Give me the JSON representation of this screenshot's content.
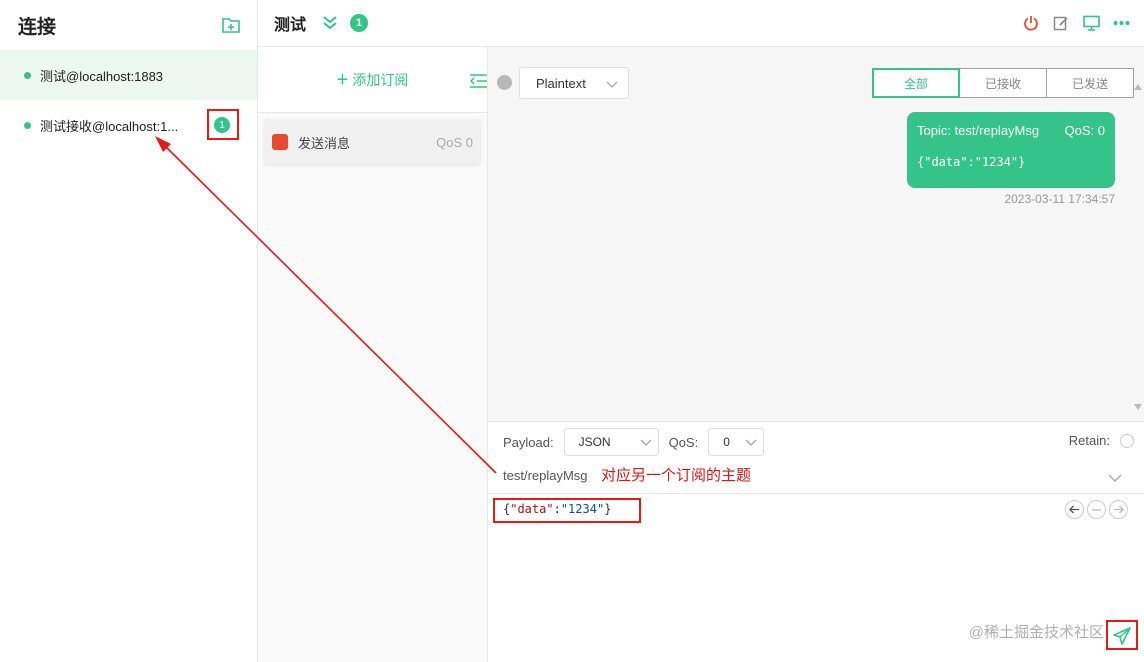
{
  "sidebar": {
    "title": "连接",
    "connections": [
      {
        "name": "测试@localhost:1883",
        "active": true
      },
      {
        "name": "测试接收@localhost:1...",
        "active": false,
        "badge": "1"
      }
    ]
  },
  "topbar": {
    "title": "测试",
    "badge": "1"
  },
  "subscriptions": {
    "add_label": "添加订阅",
    "items": [
      {
        "topic": "发送消息",
        "qos": "QoS 0",
        "color": "#e6492e"
      }
    ]
  },
  "messages": {
    "format": "Plaintext",
    "filters": [
      "全部",
      "已接收",
      "已发送"
    ],
    "active_filter": "全部",
    "items": [
      {
        "topic": "Topic: test/replayMsg",
        "qos": "QoS: 0",
        "payload": "{\"data\":\"1234\"}",
        "time": "2023-03-11 17:34:57"
      }
    ]
  },
  "composer": {
    "payload_label": "Payload:",
    "payload_format": "JSON",
    "qos_label": "QoS:",
    "qos_value": "0",
    "retain_label": "Retain:",
    "topic": "test/replayMsg",
    "annotation": "对应另一个订阅的主题",
    "payload_key": "\"data\"",
    "payload_value": "\"1234\""
  },
  "watermark": "@稀土掘金技术社区",
  "colors": {
    "accent": "#34c388",
    "annotation": "#e21b1b"
  }
}
